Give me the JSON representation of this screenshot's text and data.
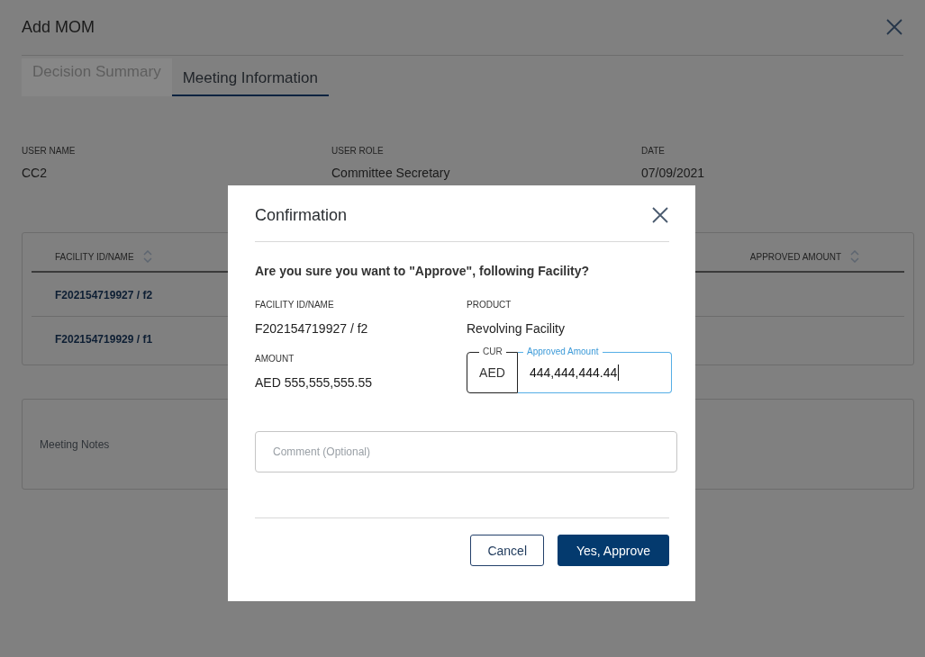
{
  "page": {
    "title": "Add MOM"
  },
  "tabs": [
    {
      "label": "Decision Summary",
      "selected": false
    },
    {
      "label": "Meeting Information",
      "selected": true
    }
  ],
  "info": [
    {
      "label": "USER NAME",
      "value": "CC2"
    },
    {
      "label": "USER ROLE",
      "value": "Committee Secretary"
    },
    {
      "label": "DATE",
      "value": "07/09/2021"
    }
  ],
  "table": {
    "columns": [
      "FACILITY ID/NAME",
      "APPROVED AMOUNT"
    ],
    "rows": [
      {
        "facility": "F202154719927 / f2"
      },
      {
        "facility": "F202154719929 / f1"
      }
    ]
  },
  "meeting_notes": {
    "placeholder": "Meeting Notes"
  },
  "dialog": {
    "title": "Confirmation",
    "question": "Are you sure you want to \"Approve\", following Facility?",
    "details": [
      {
        "label": "FACILITY ID/NAME",
        "value": "F202154719927 / f2"
      },
      {
        "label": "PRODUCT",
        "value": "Revolving Facility"
      },
      {
        "label": "AMOUNT",
        "value": "AED 555,555,555.55"
      }
    ],
    "currency": {
      "label": "CUR",
      "value": "AED"
    },
    "approved_amount": {
      "label": "Approved Amount",
      "value": "444,444,444.44",
      "focused": true
    },
    "comment": {
      "placeholder": "Comment (Optional)"
    },
    "buttons": [
      {
        "label": "Cancel",
        "kind": "secondary"
      },
      {
        "label": "Yes, Approve",
        "kind": "primary"
      }
    ]
  }
}
